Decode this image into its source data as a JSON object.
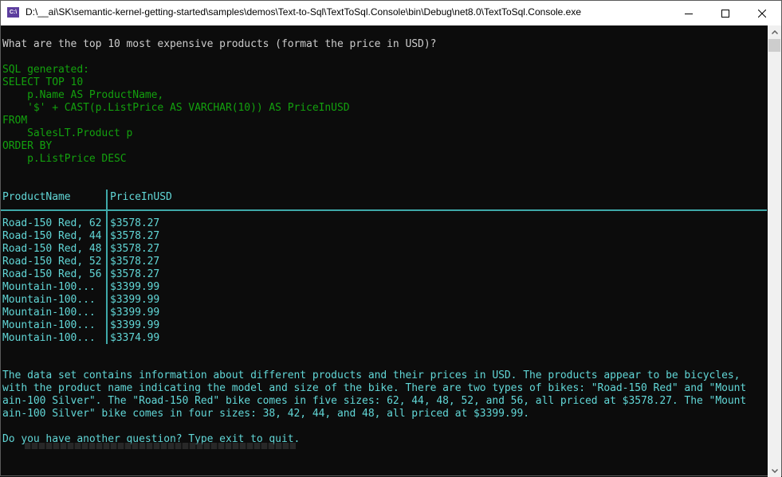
{
  "window": {
    "title": "D:\\__ai\\SK\\semantic-kernel-getting-started\\samples\\demos\\Text-to-Sql\\TextToSql.Console\\bin\\Debug\\net8.0\\TextToSql.Console.exe",
    "icon_label": "C:\\",
    "controls": {
      "minimize": "minimize-icon",
      "maximize": "maximize-icon",
      "close": "close-icon"
    }
  },
  "console": {
    "question": "What are the top 10 most expensive products (format the price in USD)?",
    "sql_label": "SQL generated:",
    "sql_lines": [
      "SELECT TOP 10",
      "    p.Name AS ProductName,",
      "    '$' + CAST(p.ListPrice AS VARCHAR(10)) AS PriceInUSD",
      "FROM",
      "    SalesLT.Product p",
      "ORDER BY",
      "    p.ListPrice DESC"
    ],
    "table": {
      "columns": [
        "ProductName",
        "PriceInUSD"
      ],
      "rows": [
        [
          "Road-150 Red, 62",
          "$3578.27"
        ],
        [
          "Road-150 Red, 44",
          "$3578.27"
        ],
        [
          "Road-150 Red, 48",
          "$3578.27"
        ],
        [
          "Road-150 Red, 52",
          "$3578.27"
        ],
        [
          "Road-150 Red, 56",
          "$3578.27"
        ],
        [
          "Mountain-100...",
          "$3399.99"
        ],
        [
          "Mountain-100...",
          "$3399.99"
        ],
        [
          "Mountain-100...",
          "$3399.99"
        ],
        [
          "Mountain-100...",
          "$3399.99"
        ],
        [
          "Mountain-100...",
          "$3374.99"
        ]
      ]
    },
    "summary_lines": [
      "The data set contains information about different products and their prices in USD. The products appear to be bicycles,",
      "with the product name indicating the model and size of the bike. There are two types of bikes: \"Road-150 Red\" and \"Mount",
      "ain-100 Silver\". The \"Road-150 Red\" bike comes in five sizes: 62, 44, 48, 52, and 56, all priced at $3578.27. The \"Mount",
      "ain-100 Silver\" bike comes in four sizes: 38, 42, 44, and 48, all priced at $3399.99."
    ],
    "prompt": "Do you have another question? Type exit to quit."
  },
  "colors": {
    "background": "#0c0c0c",
    "question_text": "#cccccc",
    "sql_text": "#13a10e",
    "result_text": "#61d6d6"
  }
}
